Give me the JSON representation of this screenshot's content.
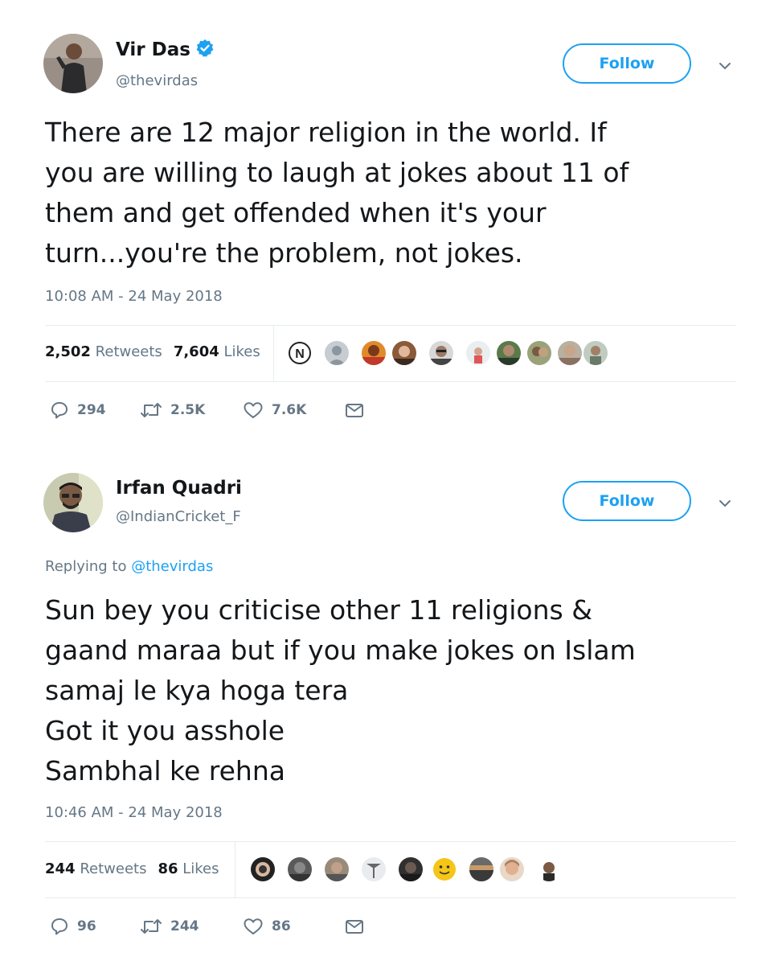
{
  "tweets": [
    {
      "name": "Vir Das",
      "verified": true,
      "handle": "@thevirdas",
      "follow_label": "Follow",
      "replying_prefix": "",
      "replying_to": "",
      "text": "There are 12 major religion in the world. If\nyou are willing to laugh at jokes about 11 of\nthem and get offended when it's your\nturn...you're the problem, not jokes.",
      "timestamp": "10:08 AM - 24 May 2018",
      "retweets_count": "2,502",
      "retweets_label": "Retweets",
      "likes_count": "7,604",
      "likes_label": "Likes",
      "reply_count": "294",
      "retweet_count_short": "2.5K",
      "like_count_short": "7.6K"
    },
    {
      "name": "Irfan Quadri",
      "verified": false,
      "handle": "@IndianCricket_F",
      "follow_label": "Follow",
      "replying_prefix": "Replying to",
      "replying_to": "@thevirdas",
      "text": "Sun bey you criticise other 11 religions &\ngaand maraa but if you make jokes on Islam\nsamaj le kya hoga tera\nGot it you asshole\nSambhal ke rehna",
      "timestamp": "10:46 AM - 24 May 2018",
      "retweets_count": "244",
      "retweets_label": "Retweets",
      "likes_count": "86",
      "likes_label": "Likes",
      "reply_count": "96",
      "retweet_count_short": "244",
      "like_count_short": "86"
    }
  ],
  "colors": {
    "accent": "#1da1f2",
    "text": "#14171a",
    "secondary": "#657786",
    "divider": "#e6ecf0"
  },
  "icons": [
    "verified-badge-icon",
    "chevron-down-icon",
    "reply-icon",
    "retweet-icon",
    "like-icon",
    "direct-message-icon"
  ]
}
